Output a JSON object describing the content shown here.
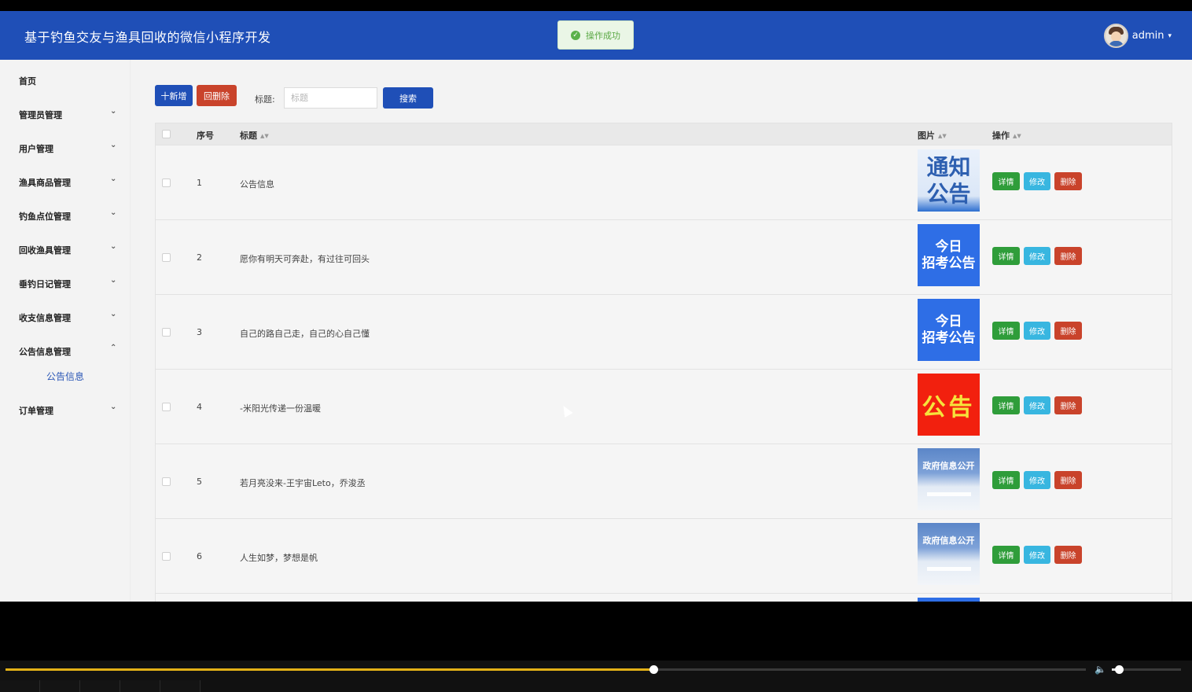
{
  "header": {
    "title": "基于钓鱼交友与渔具回收的微信小程序开发",
    "user": "admin"
  },
  "toast": {
    "message": "操作成功"
  },
  "sidebar": {
    "home": "首页",
    "items": [
      {
        "label": "管理员管理",
        "expanded": false
      },
      {
        "label": "用户管理",
        "expanded": false
      },
      {
        "label": "渔具商品管理",
        "expanded": false
      },
      {
        "label": "钓鱼点位管理",
        "expanded": false
      },
      {
        "label": "回收渔具管理",
        "expanded": false
      },
      {
        "label": "垂钓日记管理",
        "expanded": false
      },
      {
        "label": "收支信息管理",
        "expanded": false
      },
      {
        "label": "公告信息管理",
        "expanded": true,
        "children": [
          "公告信息"
        ]
      },
      {
        "label": "订单管理",
        "expanded": false
      }
    ]
  },
  "toolbar": {
    "add_label": "十新增",
    "delete_label": "回删除",
    "search_label": "标题:",
    "search_placeholder": "标题",
    "search_button": "搜索"
  },
  "table": {
    "columns": [
      "序号",
      "标题",
      "图片",
      "操作"
    ],
    "actions": {
      "view": "详情",
      "edit": "修改",
      "delete": "删除"
    },
    "rows": [
      {
        "index": "1",
        "title": "公告信息",
        "image": {
          "style": "notice-blue",
          "lines": [
            "通知",
            "公告"
          ]
        }
      },
      {
        "index": "2",
        "title": "愿你有明天可奔赴，有过往可回头",
        "image": {
          "style": "exam-blue",
          "lines": [
            "今日",
            "招考公告"
          ]
        }
      },
      {
        "index": "3",
        "title": "自己的路自己走，自己的心自己懂",
        "image": {
          "style": "exam-blue",
          "lines": [
            "今日",
            "招考公告"
          ]
        }
      },
      {
        "index": "4",
        "title": "-米阳光传递一份温暖",
        "image": {
          "style": "notice-red",
          "lines": [
            "公告"
          ]
        }
      },
      {
        "index": "5",
        "title": "若月亮没来-王宇宙Leto，乔浚丞",
        "image": {
          "style": "gov-info",
          "lines": [
            "政府信息公开"
          ]
        }
      },
      {
        "index": "6",
        "title": "人生如梦，梦想是帆",
        "image": {
          "style": "gov-info",
          "lines": [
            "政府信息公开"
          ]
        }
      }
    ]
  },
  "player": {
    "progress": 0.6,
    "volume": 0.1
  },
  "colors": {
    "primary": "#1f4fb7",
    "danger": "#c9432b",
    "success": "#2f9d3a",
    "info": "#38b6e0",
    "progress": "#e3b117"
  }
}
